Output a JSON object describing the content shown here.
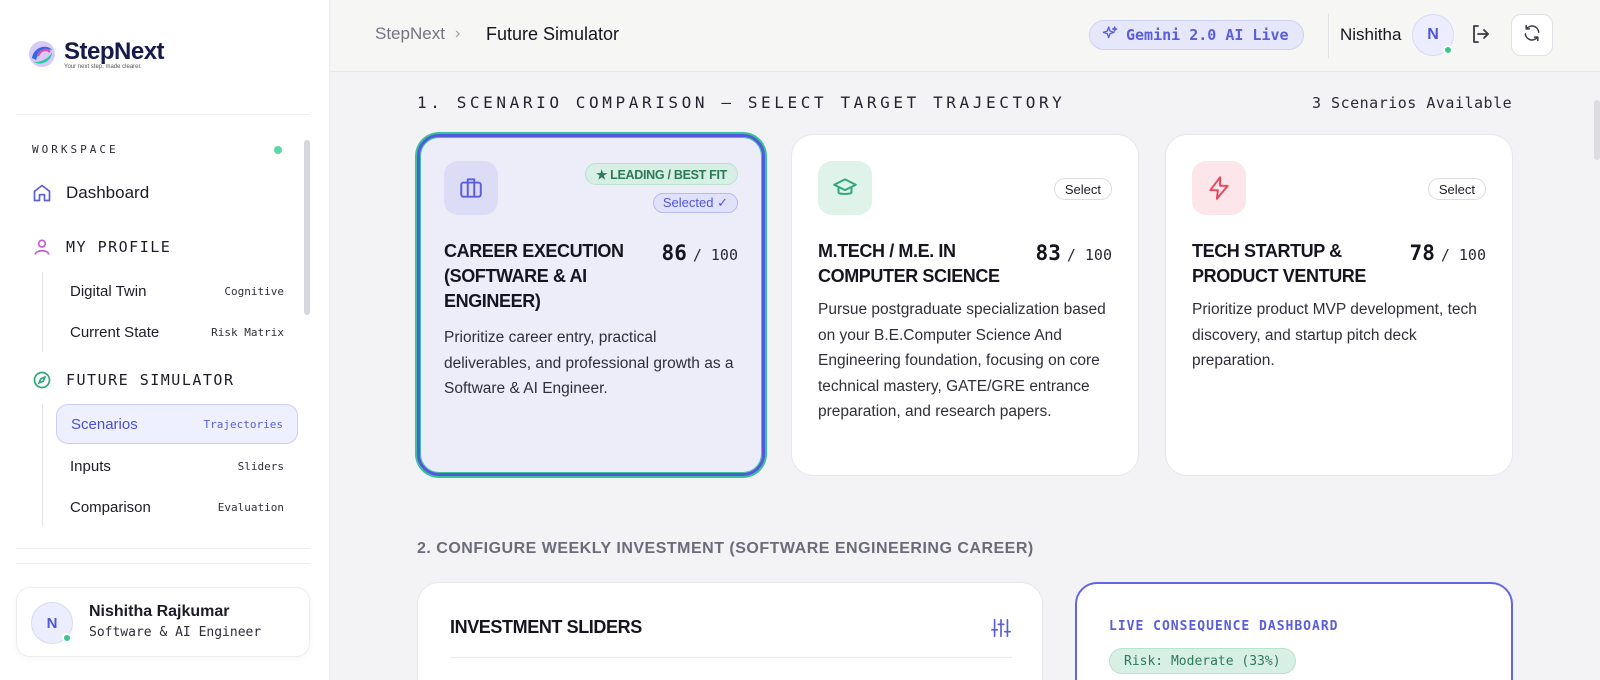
{
  "brand": {
    "name": "StepNext",
    "tagline": "Your next step, made clearer."
  },
  "sidebar": {
    "workspace_label": "WORKSPACE",
    "dashboard": "Dashboard",
    "profile": {
      "label": "MY PROFILE",
      "items": [
        {
          "label": "Digital Twin",
          "tag": "Cognitive"
        },
        {
          "label": "Current State",
          "tag": "Risk Matrix"
        }
      ]
    },
    "simulator": {
      "label": "FUTURE SIMULATOR",
      "items": [
        {
          "label": "Scenarios",
          "tag": "Trajectories",
          "active": true
        },
        {
          "label": "Inputs",
          "tag": "Sliders"
        },
        {
          "label": "Comparison",
          "tag": "Evaluation"
        }
      ]
    },
    "user": {
      "initial": "N",
      "name": "Nishitha Rajkumar",
      "role": "Software & AI Engineer"
    }
  },
  "header": {
    "breadcrumb": [
      "StepNext",
      "Future Simulator"
    ],
    "ai_badge": "Gemini 2.0 AI Live",
    "user_name": "Nishitha",
    "user_initial": "N"
  },
  "section1": {
    "title": "1. SCENARIO COMPARISON — SELECT TARGET TRAJECTORY",
    "count": "3 Scenarios Available",
    "cards": [
      {
        "title": "CAREER EXECUTION (SOFTWARE & AI ENGINEER)",
        "score": "86",
        "max": "/ 100",
        "desc": "Prioritize career entry, practical deliverables, and professional growth as a Software & AI Engineer.",
        "badge_lead": "★ LEADING / BEST FIT",
        "badge_selected": "Selected ✓",
        "icon": "briefcase-icon",
        "accent": "#5a5ed9"
      },
      {
        "title": "M.TECH / M.E. IN COMPUTER SCIENCE",
        "score": "83",
        "max": "/ 100",
        "desc": "Pursue postgraduate specialization based on your B.E.Computer Science And Engineering foundation, focusing on core technical mastery, GATE/GRE entrance preparation, and research papers.",
        "button": "Select",
        "icon": "graduation-cap-icon",
        "accent": "#2fa877"
      },
      {
        "title": "TECH STARTUP & PRODUCT VENTURE",
        "score": "78",
        "max": "/ 100",
        "desc": "Prioritize product MVP development, tech discovery, and startup pitch deck preparation.",
        "button": "Select",
        "icon": "lightning-icon",
        "accent": "#e5485f"
      }
    ]
  },
  "section2": {
    "title": "2. CONFIGURE WEEKLY INVESTMENT (SOFTWARE ENGINEERING CAREER)",
    "sliders_title": "INVESTMENT SLIDERS",
    "dashboard_title": "LIVE CONSEQUENCE DASHBOARD",
    "risk": "Risk: Moderate (33%)"
  }
}
